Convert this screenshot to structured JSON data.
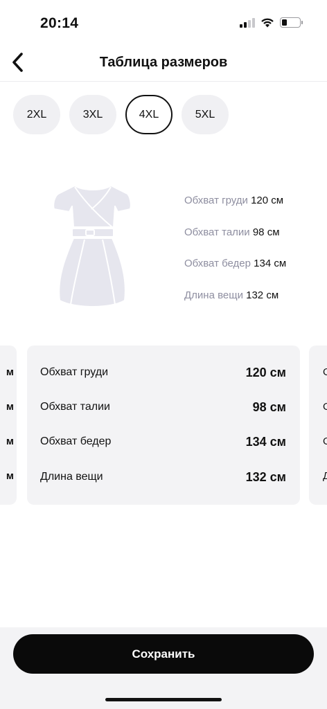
{
  "status": {
    "time": "20:14"
  },
  "nav": {
    "title": "Таблица размеров"
  },
  "sizes": [
    {
      "label": "2XL",
      "selected": false
    },
    {
      "label": "3XL",
      "selected": false
    },
    {
      "label": "4XL",
      "selected": true
    },
    {
      "label": "5XL",
      "selected": false
    }
  ],
  "summary": [
    {
      "label": "Обхват груди",
      "value": "120 см"
    },
    {
      "label": "Обхват талии",
      "value": "98 см"
    },
    {
      "label": "Обхват бедер",
      "value": "134 см"
    },
    {
      "label": "Длина вещи",
      "value": "132 см"
    }
  ],
  "card": {
    "rows": [
      {
        "label": "Обхват груди",
        "value": "120 см"
      },
      {
        "label": "Обхват талии",
        "value": "98 см"
      },
      {
        "label": "Обхват бедер",
        "value": "134 см"
      },
      {
        "label": "Длина вещи",
        "value": "132 см"
      }
    ]
  },
  "peek_left": [
    "м",
    "м",
    "м",
    "м"
  ],
  "peek_right": [
    "О",
    "О",
    "О",
    "Д"
  ],
  "actions": {
    "save_label": "Сохранить"
  },
  "colors": {
    "accent": "#0a0a0a",
    "chip_bg": "#f0f0f3",
    "card_bg": "#f3f3f5",
    "muted_text": "#8e8ea0",
    "illustration": "#e6e6ee"
  }
}
